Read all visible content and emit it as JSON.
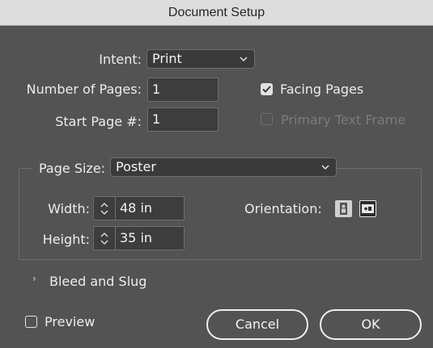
{
  "window": {
    "title": "Document Setup"
  },
  "intent": {
    "label": "Intent:",
    "value": "Print"
  },
  "pages": {
    "label": "Number of Pages:",
    "value": "1"
  },
  "start_page": {
    "label": "Start Page #:",
    "value": "1"
  },
  "facing_pages": {
    "label": "Facing Pages",
    "checked": true
  },
  "primary_text_frame": {
    "label": "Primary Text Frame",
    "checked": false,
    "enabled": false
  },
  "page_size": {
    "label": "Page Size:",
    "value": "Poster"
  },
  "width": {
    "label": "Width:",
    "value": "48 in"
  },
  "height": {
    "label": "Height:",
    "value": "35 in"
  },
  "orientation": {
    "label": "Orientation:",
    "selected": "landscape"
  },
  "bleed_slug": {
    "label": "Bleed and Slug",
    "expanded": false
  },
  "preview": {
    "label": "Preview",
    "checked": false
  },
  "buttons": {
    "cancel": "Cancel",
    "ok": "OK"
  },
  "colors": {
    "dialog_bg": "#535353",
    "titlebar_bg": "#dcdcdc",
    "field_bg": "#3d3d3d",
    "disabled_text": "#7b7b7b"
  }
}
